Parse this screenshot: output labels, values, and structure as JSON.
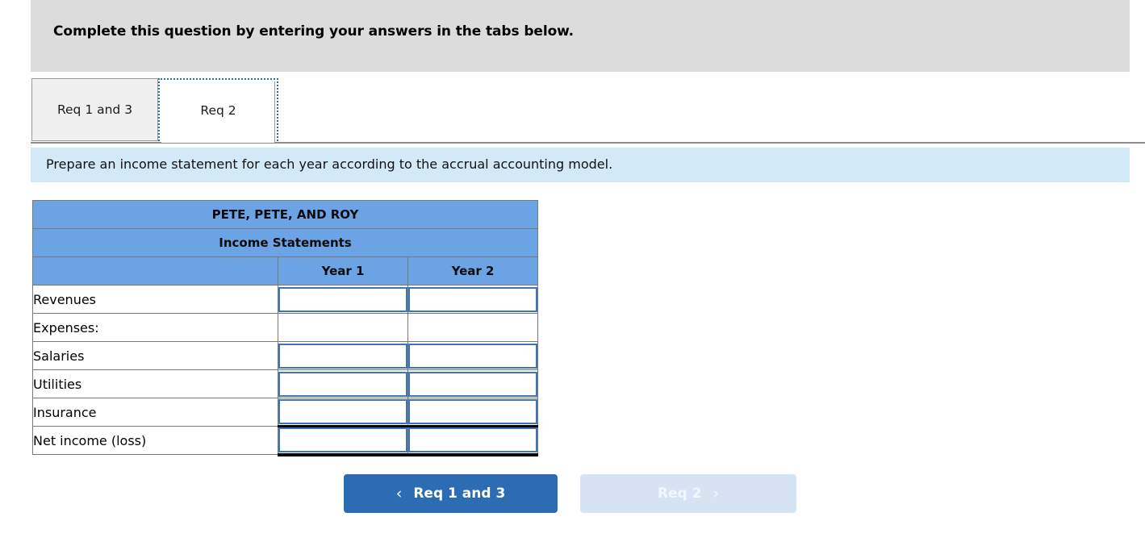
{
  "banner": {
    "text": "Complete this question by entering your answers in the tabs below."
  },
  "tabs": [
    {
      "label": "Req 1 and 3",
      "active": false
    },
    {
      "label": "Req 2",
      "active": true
    }
  ],
  "instruction": {
    "text": "Prepare an income statement for each year according to the accrual accounting model."
  },
  "statement": {
    "company": "PETE, PETE, AND ROY",
    "subtitle": "Income Statements",
    "column_headers": [
      "",
      "Year 1",
      "Year 2"
    ],
    "rows": [
      {
        "label": "Revenues",
        "indent": 0,
        "inputs": true,
        "year1": "",
        "year2": ""
      },
      {
        "label": "Expenses:",
        "indent": 0,
        "inputs": false,
        "year1": "",
        "year2": ""
      },
      {
        "label": "Salaries",
        "indent": 1,
        "inputs": true,
        "year1": "",
        "year2": ""
      },
      {
        "label": "Utilities",
        "indent": 1,
        "inputs": true,
        "year1": "",
        "year2": ""
      },
      {
        "label": "Insurance",
        "indent": 1,
        "inputs": true,
        "year1": "",
        "year2": ""
      },
      {
        "label": "Net income (loss)",
        "indent": 2,
        "inputs": true,
        "year1": "",
        "year2": ""
      }
    ]
  },
  "nav": {
    "prev_label": "Req 1 and 3",
    "prev_chevron": "‹",
    "next_label": "Req 2",
    "next_chevron": "›"
  },
  "colors": {
    "banner_gray": "#dcdcdc",
    "instruction_blue": "#d2e9f8",
    "table_header_blue": "#6ca3e4",
    "input_border_blue": "#3d75b8",
    "button_blue": "#2b6cb3",
    "button_disabled_blue": "#d6e3f2"
  }
}
